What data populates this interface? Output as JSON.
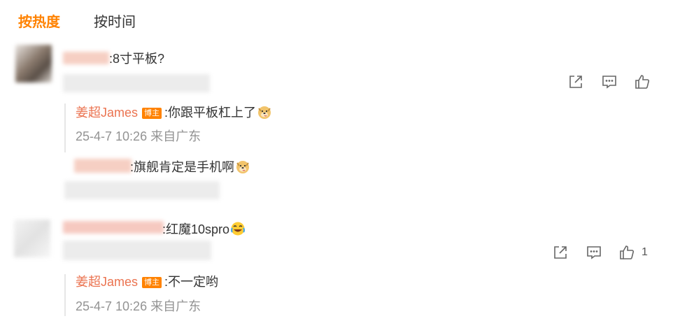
{
  "tabs": {
    "hot": "按热度",
    "time": "按时间"
  },
  "comments": [
    {
      "text": ":8寸平板?",
      "replies": [
        {
          "author": "姜超James",
          "badge": "博主",
          "text": ":你跟平板杠上了",
          "meta": "25-4-7 10:26 来自广东",
          "emoji": "doge"
        },
        {
          "text": ":旗舰肯定是手机啊",
          "emoji": "doge"
        }
      ]
    },
    {
      "text": ":红魔10spro",
      "emoji": "laugh-cry",
      "like_count": "1",
      "replies": [
        {
          "author": "姜超James",
          "badge": "博主",
          "text": ":不一定哟",
          "meta": "25-4-7 10:26 来自广东"
        }
      ]
    }
  ],
  "icons": [
    "share-icon",
    "comment-icon",
    "like-icon"
  ],
  "colors": {
    "accent": "#ff8200",
    "author": "#eb7350",
    "meta": "#939393"
  }
}
